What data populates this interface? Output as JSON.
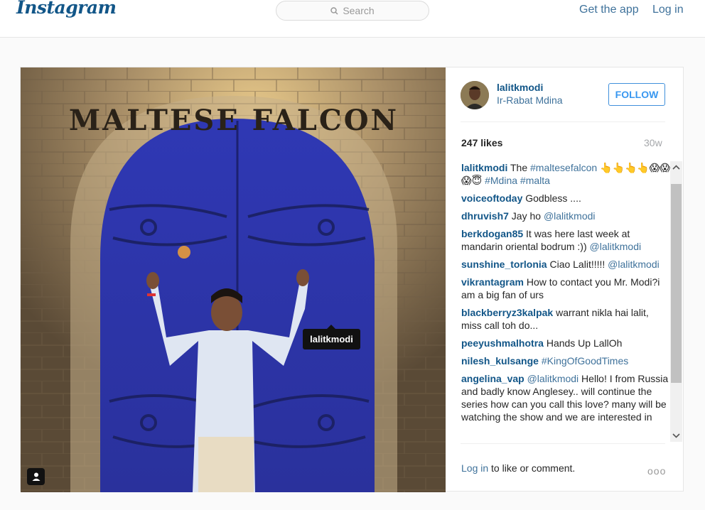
{
  "header": {
    "logo": "Instagram",
    "search_placeholder": "Search",
    "get_app": "Get the app",
    "login": "Log in"
  },
  "photo": {
    "sign_text": "MALTESE FALCON",
    "tag_label": "lalitkmodi"
  },
  "post": {
    "username": "lalitkmodi",
    "location": "Ir-Rabat Mdina",
    "follow_label": "FOLLOW",
    "likes": "247 likes",
    "age": "30w"
  },
  "comments": [
    {
      "user": "lalitkmodi",
      "parts": [
        {
          "t": "text",
          "v": " The "
        },
        {
          "t": "link",
          "v": "#maltesefalcon"
        },
        {
          "t": "text",
          "v": " 👆👆👆👆😱😱😱😇 "
        },
        {
          "t": "link",
          "v": "#Mdina"
        },
        {
          "t": "text",
          "v": " "
        },
        {
          "t": "link",
          "v": "#malta"
        }
      ]
    },
    {
      "user": "voiceoftoday",
      "parts": [
        {
          "t": "text",
          "v": " Godbless ...."
        }
      ]
    },
    {
      "user": "dhruvish7",
      "parts": [
        {
          "t": "text",
          "v": " Jay ho "
        },
        {
          "t": "link",
          "v": "@lalitkmodi"
        }
      ]
    },
    {
      "user": "berkdogan85",
      "parts": [
        {
          "t": "text",
          "v": " It was here last week at mandarin oriental bodrum :)) "
        },
        {
          "t": "link",
          "v": "@lalitkmodi"
        }
      ]
    },
    {
      "user": "sunshine_torlonia",
      "parts": [
        {
          "t": "text",
          "v": " Ciao Lalit!!!!! "
        },
        {
          "t": "link",
          "v": "@lalitkmodi"
        }
      ]
    },
    {
      "user": "vikrantagram",
      "parts": [
        {
          "t": "text",
          "v": " How to contact you Mr. Modi?i am a big fan of urs"
        }
      ]
    },
    {
      "user": "blackberryz3kalpak",
      "parts": [
        {
          "t": "text",
          "v": " warrant nikla hai lalit, miss call toh do..."
        }
      ]
    },
    {
      "user": "peeyushmalhotra",
      "parts": [
        {
          "t": "text",
          "v": " Hands Up LallOh"
        }
      ]
    },
    {
      "user": "nilesh_kulsange",
      "parts": [
        {
          "t": "text",
          "v": " "
        },
        {
          "t": "link",
          "v": "#KingOfGoodTimes"
        }
      ]
    },
    {
      "user": "angelina_vap",
      "parts": [
        {
          "t": "text",
          "v": " "
        },
        {
          "t": "link",
          "v": "@lalitkmodi"
        },
        {
          "t": "text",
          "v": " Hello! I from Russia and badly know Anglesey.. will continue the series how can you call this love? many will be watching the show and we are interested in"
        }
      ]
    }
  ],
  "footer": {
    "login_link": "Log in",
    "login_rest": " to like or comment.",
    "more": "ooo"
  },
  "colors": {
    "brand": "#125688",
    "link": "#3f729b",
    "follow": "#3897f0",
    "door": "#2b34a8"
  }
}
